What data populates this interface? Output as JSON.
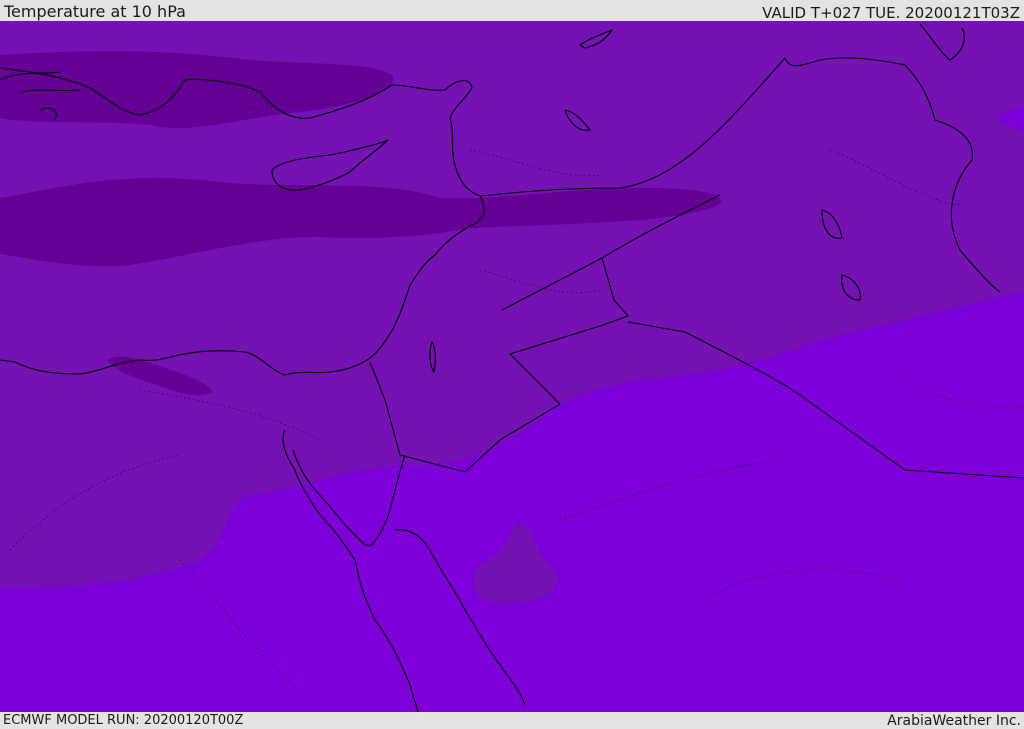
{
  "header": {
    "title": "Temperature at 10 hPa",
    "valid": "VALID T+027 TUE. 20200121T03Z"
  },
  "footer": {
    "model_run": "ECMWF MODEL RUN: 20200120T00Z",
    "credit": "ArabiaWeather Inc."
  },
  "map": {
    "colors": {
      "field_dark": "#650096",
      "field_mid": "#7412b3",
      "field_bright": "#7d00d9",
      "coastline": "#000000"
    }
  }
}
